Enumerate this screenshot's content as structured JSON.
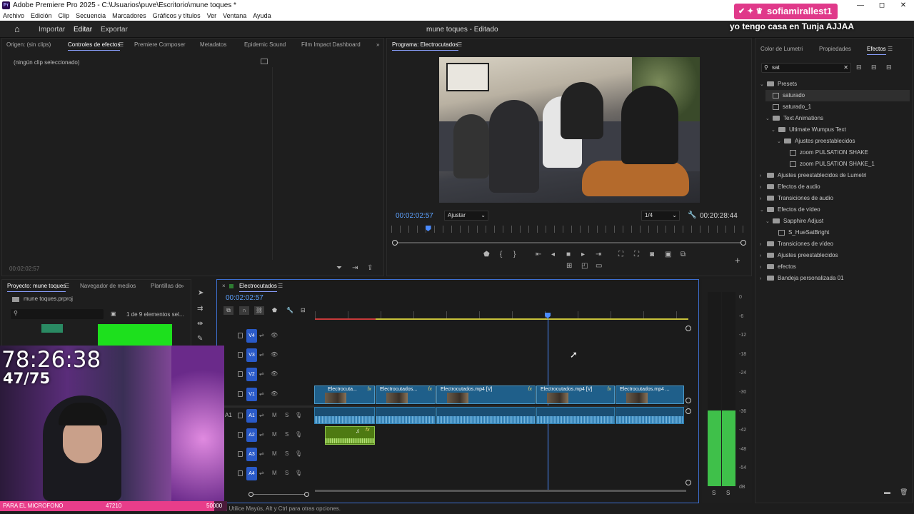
{
  "window": {
    "title": "Adobe Premiere Pro 2025 - C:\\Usuarios\\puve\\Escritorio\\mune toques *",
    "controls": [
      "—",
      "◻",
      "✕"
    ]
  },
  "menu": [
    "Archivo",
    "Edición",
    "Clip",
    "Secuencia",
    "Marcadores",
    "Gráficos y títulos",
    "Ver",
    "Ventana",
    "Ayuda"
  ],
  "appbar": {
    "nav": [
      "Importar",
      "Editar",
      "Exportar"
    ],
    "doc_title": "mune toques - Editado"
  },
  "source_panel": {
    "tabs": [
      "Origen: (sin clips)",
      "Controles de efectos",
      "Premiere Composer",
      "Metadatos",
      "Epidemic Sound",
      "Film Impact Dashboard"
    ],
    "active_tab": "Controles de efectos",
    "empty_text": "(ningún clip seleccionado)",
    "timecode": "00:02:02:57"
  },
  "program_monitor": {
    "tab": "Programa: Electrocutados",
    "timecode": "00:02:02:57",
    "fit": "Ajustar",
    "resolution": "1/4",
    "duration": "00:20:28:44",
    "playhead_fraction": 0.1
  },
  "effects_panel": {
    "tabs": [
      "Color de Lumetri",
      "Propiedades",
      "Efectos"
    ],
    "active_tab": "Efectos",
    "search_value": "sat",
    "tree": [
      {
        "label": "Presets",
        "level": 0,
        "kind": "folder",
        "arrow": "⌄"
      },
      {
        "label": "saturado",
        "level": 1,
        "kind": "file",
        "arrow": ""
      },
      {
        "label": "saturado_1",
        "level": 1,
        "kind": "file",
        "arrow": ""
      },
      {
        "label": "Text Animations",
        "level": 1,
        "kind": "folder",
        "arrow": "⌄"
      },
      {
        "label": "Ultimate Wumpus Text",
        "level": 2,
        "kind": "folder",
        "arrow": "⌄"
      },
      {
        "label": "Ajustes preestablecidos",
        "level": 3,
        "kind": "folder",
        "arrow": "⌄"
      },
      {
        "label": "zoom PULSATION SHAKE",
        "level": 4,
        "kind": "file",
        "arrow": ""
      },
      {
        "label": "zoom PULSATION SHAKE_1",
        "level": 4,
        "kind": "file",
        "arrow": ""
      },
      {
        "label": "Ajustes preestablecidos de Lumetri",
        "level": 0,
        "kind": "folder",
        "arrow": "›"
      },
      {
        "label": "Efectos de audio",
        "level": 0,
        "kind": "folder",
        "arrow": "›"
      },
      {
        "label": "Transiciones de audio",
        "level": 0,
        "kind": "folder",
        "arrow": "›"
      },
      {
        "label": "Efectos de vídeo",
        "level": 0,
        "kind": "folder",
        "arrow": "⌄"
      },
      {
        "label": "Sapphire Adjust",
        "level": 1,
        "kind": "folder",
        "arrow": "⌄"
      },
      {
        "label": "S_HueSatBright",
        "level": 2,
        "kind": "file",
        "arrow": ""
      },
      {
        "label": "Transiciones de vídeo",
        "level": 0,
        "kind": "folder",
        "arrow": "›"
      },
      {
        "label": "Ajustes preestablecidos",
        "level": 0,
        "kind": "folder",
        "arrow": "›"
      },
      {
        "label": "efectos",
        "level": 0,
        "kind": "folder",
        "arrow": "›"
      },
      {
        "label": "Bandeja personalizada 01",
        "level": 0,
        "kind": "folder",
        "arrow": "›"
      }
    ]
  },
  "project_panel": {
    "tabs": [
      "Proyecto: mune toques",
      "Navegador de medios",
      "Plantillas de"
    ],
    "file": "mune toques.prproj",
    "count": "1 de 9 elementos sel..."
  },
  "timeline": {
    "sequence": "Electrocutados",
    "timecode": "00:02:02:57",
    "tracks_video": [
      "V4",
      "V3",
      "V2",
      "V1"
    ],
    "tracks_audio": [
      "A1",
      "A2",
      "A3",
      "A4"
    ],
    "a1_source": "A1",
    "mute_label": "M",
    "solo_label": "S",
    "clips_v1": [
      "Electrocuta...",
      "Electrocutados...",
      "Electrocutados.mp4 [V]",
      "Electrocutados.mp4 [V]",
      "Electrocutados.mp4 ..."
    ],
    "fx_label": "fx"
  },
  "audio_meter": {
    "scale": [
      "0",
      "-6",
      "-12",
      "-18",
      "-24",
      "-30",
      "-36",
      "-42",
      "-48",
      "-54",
      "dB"
    ],
    "channels": [
      "S",
      "S"
    ],
    "level_db": -36
  },
  "status_bar": {
    "hint": ". Utilice Mayús, Alt y Ctrl para otras opciones."
  },
  "stream_overlay": {
    "chat_user": "sofiamirallest1",
    "chat_message": "yo tengo casa en Tunja AJJAA",
    "timer": "78:26:38",
    "counter": "47/75",
    "goal_label": "PARA EL MICROFONO",
    "goal_value": "47210",
    "goal_target": "50000",
    "goal_fraction": 0.944
  },
  "colors": {
    "accent_blue": "#4a8bff",
    "timecode_blue": "#5da2ff",
    "clip_video": "#1f5f8a",
    "clip_audio_green": "#4e7a12",
    "meter_green": "#3fc04a",
    "goal_pink": "#e83d8a",
    "chat_pink": "#e0398a"
  }
}
